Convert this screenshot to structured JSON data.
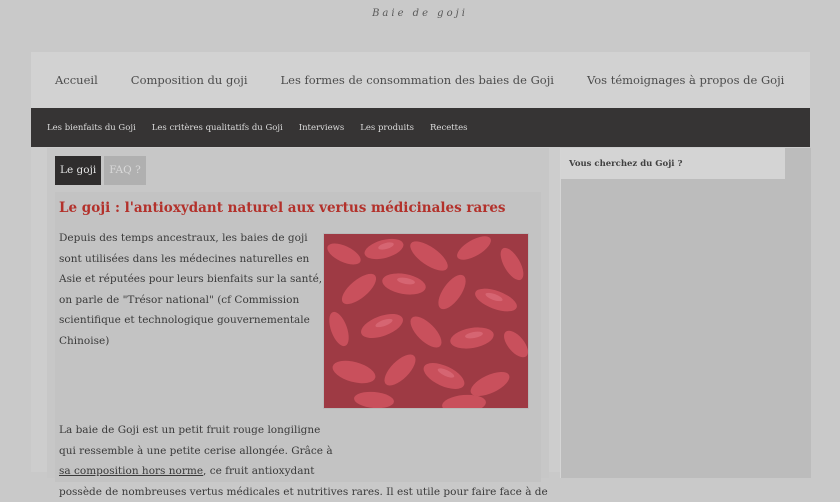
{
  "site": {
    "tagline": "Baie de goji"
  },
  "topnav": [
    {
      "label": "Accueil"
    },
    {
      "label": "Composition du goji"
    },
    {
      "label": "Les formes de consommation des baies de Goji"
    },
    {
      "label": "Vos témoignages à propos de Goji"
    }
  ],
  "subnav": [
    {
      "label": "Les bienfaits du Goji"
    },
    {
      "label": "Les critères qualitatifs du Goji"
    },
    {
      "label": "Interviews"
    },
    {
      "label": "Les produits"
    },
    {
      "label": "Recettes"
    }
  ],
  "tabs": [
    {
      "label": "Le goji",
      "active": true
    },
    {
      "label": "FAQ ?",
      "active": false
    }
  ],
  "article": {
    "title": "Le goji : l'antioxydant naturel aux vertus médicinales rares",
    "p1_lines": [
      "Depuis des temps ancestraux, les baies de goji",
      "sont utilisées dans les médecines naturelles en",
      "Asie et réputées pour leurs bienfaits sur la santé,",
      "on parle de \"Trésor national\" (cf Commission",
      "scientifique et technologique gouvernementale",
      "Chinoise)"
    ],
    "p2": {
      "line1": "La baie de Goji est un petit fruit rouge longiligne",
      "line2": "qui ressemble à une petite cerise allongée. Grâce à",
      "link": "sa composition hors norme",
      "line3_after": ", ce fruit antioxydant",
      "line4": "possède de nombreuses vertus médicales et nutritives rares. Il est utile pour faire face à de"
    },
    "image_alt": "goji-berries-photo"
  },
  "sidebar": {
    "heading": "Vous cherchez du Goji ?"
  },
  "colors": {
    "title_red": "#b3312b",
    "subnav_bg": "#363434",
    "active_tab": "#2f2d2d"
  }
}
